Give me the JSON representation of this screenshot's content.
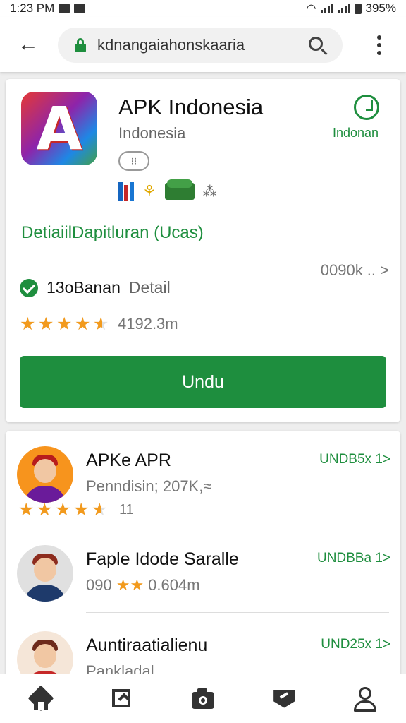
{
  "status_bar": {
    "time": "1:23 PM",
    "battery": "395%"
  },
  "browser": {
    "url": "kdnangaiahonskaaria"
  },
  "app": {
    "title": "APK Indonesia",
    "subtitle": "Indonesia",
    "share_label": "Indonan",
    "details_link": "DetiaiilDapitluran (Ucas)",
    "meta_right": "0090k .. >",
    "verified_main": "13oBanan",
    "verified_detail": "Detail",
    "rating": 4.5,
    "rating_count": "4192.3m",
    "install_label": "Undu"
  },
  "list": [
    {
      "title": "APKe APR",
      "subtitle": "Penndisin; 207K,≈",
      "rating": 4.5,
      "rating_text": "11",
      "action": "UNDB5x 1>"
    },
    {
      "title": "Faple Idode Saralle",
      "subtitle": "090",
      "rating_text": "0.604m",
      "action": "UNDBBa 1>"
    },
    {
      "title": "Auntiraatialienu",
      "subtitle": "Pankladal",
      "action": "UND25x 1>"
    }
  ],
  "colors": {
    "accent": "#1e8e3e",
    "star": "#f29a1d"
  },
  "icons": [
    "back-icon",
    "lock-icon",
    "search-icon",
    "more-icon",
    "share-icon",
    "verified-check-icon",
    "home-icon",
    "apps-icon",
    "camera-icon",
    "tag-icon",
    "profile-icon"
  ]
}
